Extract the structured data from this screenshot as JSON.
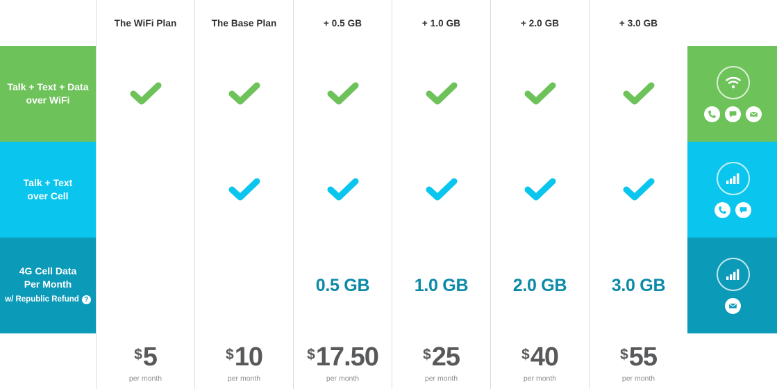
{
  "colors": {
    "green": "#6ec25a",
    "cyan": "#0ac6ee",
    "teal": "#0b9ab8",
    "divider": "#d9dcdd",
    "price_text": "#58595b",
    "period_text": "#8b8d8f",
    "header_text": "#2e3033"
  },
  "header": {
    "corner": "",
    "columns": [
      {
        "label": "The WiFi Plan"
      },
      {
        "label": "The Base Plan"
      },
      {
        "label": "+ 0.5 GB"
      },
      {
        "label": "+ 1.0 GB"
      },
      {
        "label": "+ 2.0 GB"
      },
      {
        "label": "+ 3.0 GB"
      },
      {
        "label": ""
      }
    ]
  },
  "rows": [
    {
      "id": "talk-text-data-wifi",
      "label_line1": "Talk + Text + Data",
      "label_line2": "over WiFi",
      "sublabel": "",
      "accent": "#6ec25a",
      "cells": [
        "check",
        "check",
        "check",
        "check",
        "check",
        "check"
      ],
      "icons": {
        "primary": "wifi-icon",
        "secondary": [
          "phone-icon",
          "chat-icon",
          "envelope-icon"
        ]
      }
    },
    {
      "id": "talk-text-cell",
      "label_line1": "Talk + Text",
      "label_line2": "over Cell",
      "sublabel": "",
      "accent": "#0ac6ee",
      "cells": [
        "",
        "check",
        "check",
        "check",
        "check",
        "check"
      ],
      "icons": {
        "primary": "signal-bars-icon",
        "secondary": [
          "phone-icon",
          "chat-icon"
        ]
      }
    },
    {
      "id": "4g-cell-data",
      "label_line1": "4G Cell Data",
      "label_line2": "Per Month",
      "sublabel": "w/ Republic Refund",
      "sublabel_badge": "?",
      "accent": "#0b9ab8",
      "cells": [
        "",
        "",
        "0.5 GB",
        "1.0 GB",
        "2.0 GB",
        "3.0 GB"
      ],
      "icons": {
        "primary": "signal-bars-icon",
        "secondary": [
          "envelope-icon"
        ]
      }
    }
  ],
  "prices": [
    {
      "currency": "$",
      "amount": "5",
      "period": "per month"
    },
    {
      "currency": "$",
      "amount": "10",
      "period": "per month"
    },
    {
      "currency": "$",
      "amount": "17.50",
      "period": "per month"
    },
    {
      "currency": "$",
      "amount": "25",
      "period": "per month"
    },
    {
      "currency": "$",
      "amount": "40",
      "period": "per month"
    },
    {
      "currency": "$",
      "amount": "55",
      "period": "per month"
    }
  ]
}
